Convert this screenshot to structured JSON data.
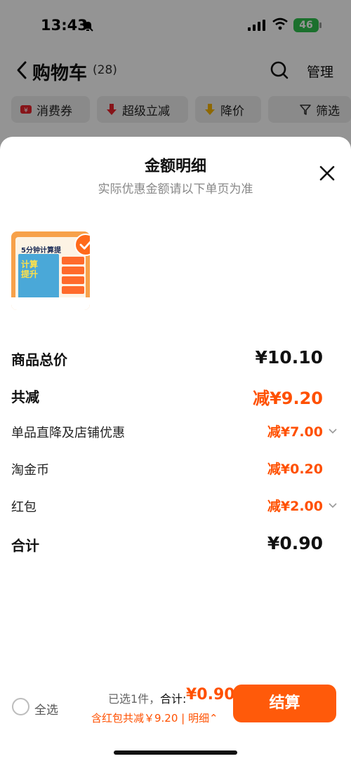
{
  "status_bar": {
    "time": "13:43",
    "battery": "46"
  },
  "nav": {
    "title": "购物车",
    "count": "(28)",
    "manage": "管理"
  },
  "filters": [
    "消费券",
    "超级立减",
    "降价",
    "筛选"
  ],
  "sheet": {
    "title": "金额明细",
    "subtitle": "实际优惠金额请以下单页为准",
    "product_thumb": {
      "headline": "5分钟计算提",
      "book_text": "计算\n提升"
    },
    "rows": [
      {
        "label": "商品总价",
        "value": "¥10.10"
      },
      {
        "label": "共减",
        "value": "减¥9.20"
      },
      {
        "label": "单品直降及店铺优惠",
        "value": "减¥7.00"
      },
      {
        "label": "淘金币",
        "value": "减¥0.20"
      },
      {
        "label": "红包",
        "value": "减¥2.00"
      },
      {
        "label": "合计",
        "value": "¥0.90"
      }
    ]
  },
  "bottom_bar": {
    "select_all": "全选",
    "selected": "已选1件，",
    "total_label": "合计:",
    "total_value": "¥0.90",
    "discount_line": "含红包共减￥9.20 | 明细⌃",
    "checkout": "结算"
  },
  "colors": {
    "accent": "#ff5000",
    "battery": "#2fc24e"
  }
}
